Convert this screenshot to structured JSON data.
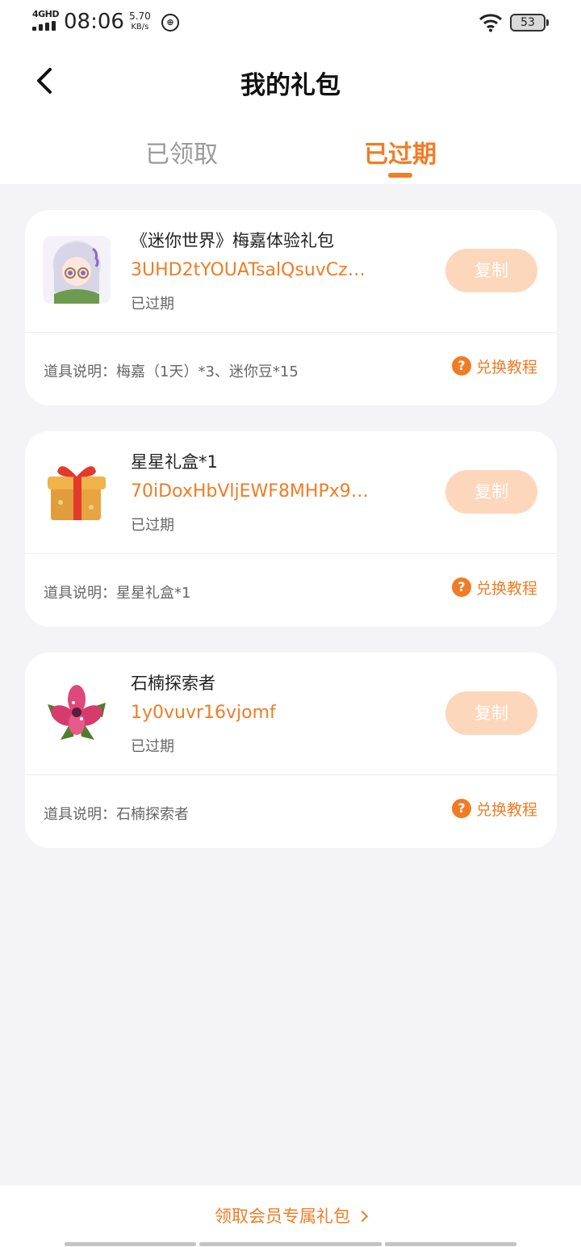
{
  "status_bar": {
    "network": "4GHD",
    "time": "08:06",
    "speed_value": "5.70",
    "speed_unit": "KB/s",
    "battery": "53",
    "icons": [
      "signal-icon",
      "speed-limit-icon",
      "wifi-icon",
      "battery-icon"
    ]
  },
  "header": {
    "title": "我的礼包",
    "back_icon": "chevron-left-icon"
  },
  "tabs": [
    {
      "label": "已领取",
      "active": false
    },
    {
      "label": "已过期",
      "active": true
    }
  ],
  "gifts": [
    {
      "icon": "anime-character-avatar",
      "name": "《迷你世界》梅嘉体验礼包",
      "code": "3UHD2tYOUATsalQsuvCz…",
      "status": "已过期",
      "copy_label": "复制",
      "desc": "道具说明：梅嘉（1天）*3、迷你豆*15",
      "tutorial_label": "兑换教程"
    },
    {
      "icon": "gift-box-icon",
      "name": "星星礼盒*1",
      "code": "70iDoxHbVljEWF8MHPx9…",
      "status": "已过期",
      "copy_label": "复制",
      "desc": "道具说明：星星礼盒*1",
      "tutorial_label": "兑换教程"
    },
    {
      "icon": "pink-flower-icon",
      "name": "石楠探索者",
      "code": "1y0vuvr16vjomf",
      "status": "已过期",
      "copy_label": "复制",
      "desc": "道具说明：石楠探索者",
      "tutorial_label": "兑换教程"
    }
  ],
  "footer": {
    "vip_link": "领取会员专属礼包"
  },
  "colors": {
    "accent": "#f07c25",
    "copy_disabled": "#fdd7bb",
    "background": "#f4f4f6"
  }
}
